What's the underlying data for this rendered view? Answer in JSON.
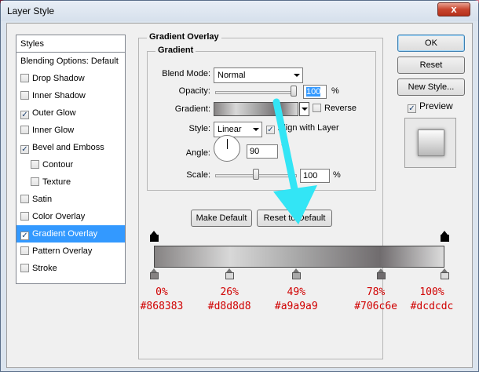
{
  "window": {
    "title": "Layer Style",
    "close_glyph": "x"
  },
  "styles_list": {
    "header": "Styles",
    "items": [
      {
        "label": "Blending Options: Default",
        "checkbox": false,
        "checked": false,
        "indent": false,
        "selected": false
      },
      {
        "label": "Drop Shadow",
        "checkbox": true,
        "checked": false,
        "indent": false,
        "selected": false
      },
      {
        "label": "Inner Shadow",
        "checkbox": true,
        "checked": false,
        "indent": false,
        "selected": false
      },
      {
        "label": "Outer Glow",
        "checkbox": true,
        "checked": true,
        "indent": false,
        "selected": false
      },
      {
        "label": "Inner Glow",
        "checkbox": true,
        "checked": false,
        "indent": false,
        "selected": false
      },
      {
        "label": "Bevel and Emboss",
        "checkbox": true,
        "checked": true,
        "indent": false,
        "selected": false
      },
      {
        "label": "Contour",
        "checkbox": true,
        "checked": false,
        "indent": true,
        "selected": false
      },
      {
        "label": "Texture",
        "checkbox": true,
        "checked": false,
        "indent": true,
        "selected": false
      },
      {
        "label": "Satin",
        "checkbox": true,
        "checked": false,
        "indent": false,
        "selected": false
      },
      {
        "label": "Color Overlay",
        "checkbox": true,
        "checked": false,
        "indent": false,
        "selected": false
      },
      {
        "label": "Gradient Overlay",
        "checkbox": true,
        "checked": true,
        "indent": false,
        "selected": true
      },
      {
        "label": "Pattern Overlay",
        "checkbox": true,
        "checked": false,
        "indent": false,
        "selected": false
      },
      {
        "label": "Stroke",
        "checkbox": true,
        "checked": false,
        "indent": false,
        "selected": false
      }
    ]
  },
  "overlay": {
    "group_title": "Gradient Overlay",
    "inner_title": "Gradient",
    "blend_mode_label": "Blend Mode:",
    "blend_mode_value": "Normal",
    "opacity_label": "Opacity:",
    "opacity_value": "100",
    "opacity_fraction": 1.0,
    "gradient_label": "Gradient:",
    "reverse_label": "Reverse",
    "style_label": "Style:",
    "style_value": "Linear",
    "align_label": "Align with Layer",
    "angle_label": "Angle:",
    "angle_value": "90",
    "angle_unit": "°",
    "scale_label": "Scale:",
    "scale_value": "100",
    "scale_fraction": 0.5,
    "percent": "%",
    "make_default": "Make Default",
    "reset_default": "Reset to Default"
  },
  "gradient_stops": [
    {
      "position": "0%",
      "color": "#868383",
      "fraction": 0.0
    },
    {
      "position": "26%",
      "color": "#d8d8d8",
      "fraction": 0.26
    },
    {
      "position": "49%",
      "color": "#a9a9a9",
      "fraction": 0.49
    },
    {
      "position": "78%",
      "color": "#706c6e",
      "fraction": 0.78
    },
    {
      "position": "100%",
      "color": "#dcdcdc",
      "fraction": 1.0
    }
  ],
  "right_panel": {
    "ok": "OK",
    "reset": "Reset",
    "new_style": "New Style...",
    "preview": "Preview",
    "preview_checked": true
  },
  "colors": {
    "selection": "#3399ff",
    "label_red": "#d00000",
    "annotation_cyan": "#33e5f5"
  }
}
